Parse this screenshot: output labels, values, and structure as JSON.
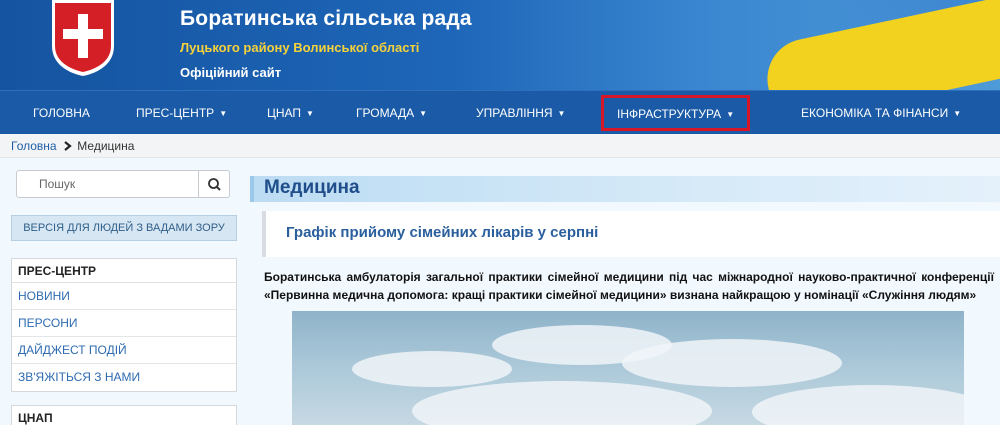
{
  "header": {
    "title": "Боратинська сільська рада",
    "subtitle": "Луцького району Волинської області",
    "official": "Офіційний сайт"
  },
  "nav": {
    "items": [
      {
        "label": "ГОЛОВНА",
        "has_dropdown": false
      },
      {
        "label": "ПРЕС-ЦЕНТР",
        "has_dropdown": true
      },
      {
        "label": "ЦНАП",
        "has_dropdown": true
      },
      {
        "label": "ГРОМАДА",
        "has_dropdown": true
      },
      {
        "label": "УПРАВЛІННЯ",
        "has_dropdown": true
      },
      {
        "label": "ІНФРАСТРУКТУРА",
        "has_dropdown": true,
        "highlighted": true
      },
      {
        "label": "ЕКОНОМІКА ТА ФІНАНСИ",
        "has_dropdown": true
      }
    ],
    "caret": "▼"
  },
  "breadcrumb": {
    "home": "Головна",
    "separator_icon": "chevron-right-icon",
    "current": "Медицина"
  },
  "sidebar": {
    "search_placeholder": "Пошук",
    "vision_label": "ВЕРСІЯ ДЛЯ ЛЮДЕЙ З ВАДАМИ ЗОРУ",
    "press": {
      "title": "ПРЕС-ЦЕНТР",
      "items": [
        "НОВИНИ",
        "ПЕРСОНИ",
        "ДАЙДЖЕСТ ПОДІЙ",
        "ЗВ'ЯЖІТЬСЯ З НАМИ"
      ]
    },
    "cnap": {
      "title": "ЦНАП"
    }
  },
  "content": {
    "title": "Медицина",
    "article_title": "Графік прийому сімейних лікарів у серпні",
    "article_text": "Боратинська амбулаторія загальної практики сімейної медицини під час міжнародної науково-практичної конференції «Первинна медична допомога: кращі практики сімейної медицини» визнана найкращою у номінації «Служіння людям»"
  },
  "colors": {
    "header_blue": "#1554a0",
    "nav_blue": "#1a5aa6",
    "flag_yellow": "#f2d21e",
    "highlight_red": "#d6172a",
    "link_blue": "#2e6bb0"
  }
}
